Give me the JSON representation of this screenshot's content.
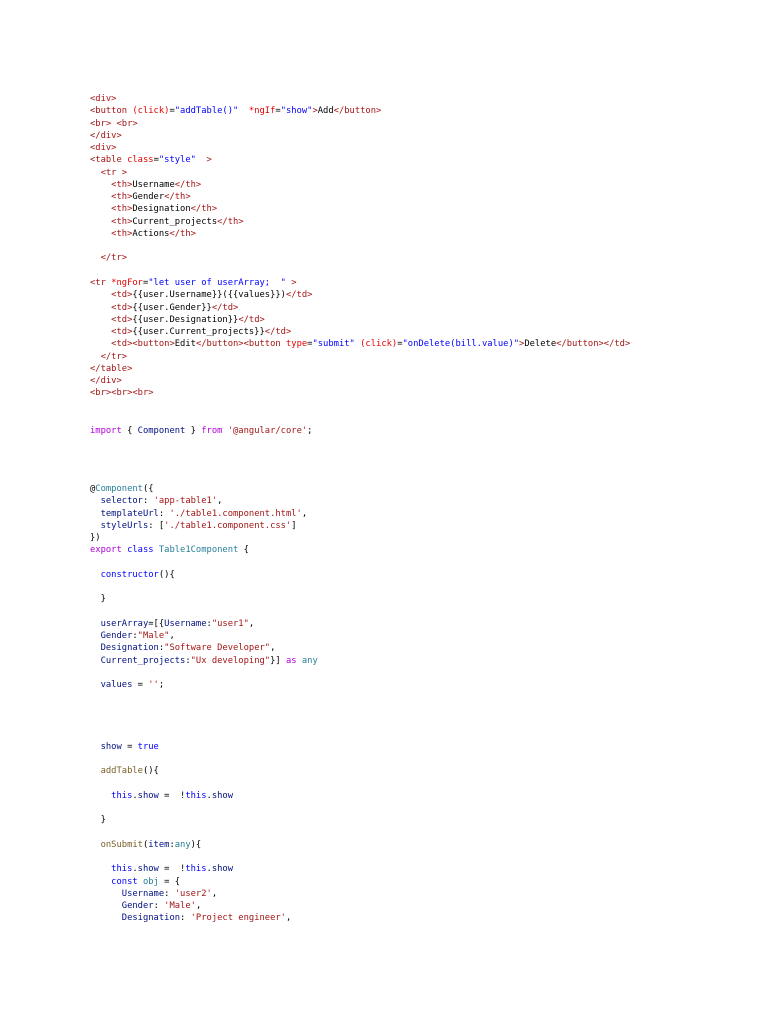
{
  "blocks": [
    {
      "name": "html-template-code",
      "lines": [
        [
          [
            "t",
            "<div>"
          ]
        ],
        [
          [
            "t",
            "<button "
          ],
          [
            "a",
            "(click)"
          ],
          [
            "x",
            "="
          ],
          [
            "v",
            "\"addTable()\""
          ],
          [
            "x",
            "  "
          ],
          [
            "a",
            "*ngIf"
          ],
          [
            "x",
            "="
          ],
          [
            "v",
            "\"show\""
          ],
          [
            "t",
            ">"
          ],
          [
            "x",
            "Add"
          ],
          [
            "t",
            "</button>"
          ]
        ],
        [
          [
            "t",
            "<br> <br>"
          ]
        ],
        [
          [
            "t",
            "</div>"
          ]
        ],
        [
          [
            "t",
            "<div>"
          ]
        ],
        [
          [
            "t",
            "<table "
          ],
          [
            "a",
            "class"
          ],
          [
            "x",
            "="
          ],
          [
            "v",
            "\"style\""
          ],
          [
            "t",
            "  >"
          ]
        ],
        [
          [
            "t",
            "  <tr >"
          ]
        ],
        [
          [
            "t",
            "    <th>"
          ],
          [
            "x",
            "Username"
          ],
          [
            "t",
            "</th>"
          ]
        ],
        [
          [
            "t",
            "    <th>"
          ],
          [
            "x",
            "Gender"
          ],
          [
            "t",
            "</th>"
          ]
        ],
        [
          [
            "t",
            "    <th>"
          ],
          [
            "x",
            "Designation"
          ],
          [
            "t",
            "</th>"
          ]
        ],
        [
          [
            "t",
            "    <th>"
          ],
          [
            "x",
            "Current_projects"
          ],
          [
            "t",
            "</th>"
          ]
        ],
        [
          [
            "t",
            "    <th>"
          ],
          [
            "x",
            "Actions"
          ],
          [
            "t",
            "</th>"
          ]
        ],
        [],
        [
          [
            "t",
            "  </tr>"
          ]
        ],
        [],
        [
          [
            "t",
            "<tr "
          ],
          [
            "a",
            "*ngFor"
          ],
          [
            "x",
            "="
          ],
          [
            "v",
            "\"let user of userArray;  \""
          ],
          [
            "t",
            " >"
          ]
        ],
        [
          [
            "t",
            "    <td>"
          ],
          [
            "x",
            "{{user.Username}}({{values}})"
          ],
          [
            "t",
            "</td>"
          ]
        ],
        [
          [
            "t",
            "    <td>"
          ],
          [
            "x",
            "{{user.Gender}}"
          ],
          [
            "t",
            "</td>"
          ]
        ],
        [
          [
            "t",
            "    <td>"
          ],
          [
            "x",
            "{{user.Designation}}"
          ],
          [
            "t",
            "</td>"
          ]
        ],
        [
          [
            "t",
            "    <td>"
          ],
          [
            "x",
            "{{user.Current_projects}}"
          ],
          [
            "t",
            "</td>"
          ]
        ],
        [
          [
            "t",
            "    <td><button>"
          ],
          [
            "x",
            "Edit"
          ],
          [
            "t",
            "</button><button "
          ],
          [
            "a",
            "type"
          ],
          [
            "x",
            "="
          ],
          [
            "v",
            "\"submit\""
          ],
          [
            "x",
            " "
          ],
          [
            "a",
            "(click)"
          ],
          [
            "x",
            "="
          ],
          [
            "v",
            "\"onDelete(bill.value)\""
          ],
          [
            "t",
            ">"
          ],
          [
            "x",
            "Delete"
          ],
          [
            "t",
            "</button></td>"
          ]
        ],
        [
          [
            "t",
            "  </tr>"
          ]
        ],
        [
          [
            "t",
            "</table>"
          ]
        ],
        [
          [
            "t",
            "</div>"
          ]
        ],
        [
          [
            "t",
            "<br><br><br>"
          ]
        ]
      ]
    },
    {
      "name": "import-code",
      "lines": [
        [
          [
            "k",
            "import"
          ],
          [
            "p",
            " { "
          ],
          [
            "i",
            "Component"
          ],
          [
            "p",
            " } "
          ],
          [
            "k",
            "from"
          ],
          [
            "p",
            " "
          ],
          [
            "s",
            "'@angular/core'"
          ],
          [
            "p",
            ";"
          ]
        ]
      ]
    },
    {
      "name": "component-code",
      "lines": [
        [
          [
            "p",
            "@"
          ],
          [
            "c",
            "Component"
          ],
          [
            "p",
            "({"
          ]
        ],
        [
          [
            "i",
            "  selector"
          ],
          [
            "p",
            ": "
          ],
          [
            "s",
            "'app-table1'"
          ],
          [
            "p",
            ","
          ]
        ],
        [
          [
            "i",
            "  templateUrl"
          ],
          [
            "p",
            ": "
          ],
          [
            "s",
            "'./table1.component.html'"
          ],
          [
            "p",
            ","
          ]
        ],
        [
          [
            "i",
            "  styleUrls"
          ],
          [
            "p",
            ": ["
          ],
          [
            "s",
            "'./table1.component.css'"
          ],
          [
            "p",
            "]"
          ]
        ],
        [
          [
            "p",
            "})"
          ]
        ],
        [
          [
            "k",
            "export"
          ],
          [
            "p",
            " "
          ],
          [
            "b",
            "class"
          ],
          [
            "p",
            " "
          ],
          [
            "c",
            "Table1Component"
          ],
          [
            "p",
            " {"
          ]
        ],
        [],
        [
          [
            "b",
            "  constructor"
          ],
          [
            "p",
            "(){"
          ]
        ],
        [],
        [
          [
            "p",
            "  }"
          ]
        ],
        [],
        [
          [
            "i",
            "  userArray"
          ],
          [
            "p",
            "=[{"
          ],
          [
            "i",
            "Username"
          ],
          [
            "p",
            ":"
          ],
          [
            "s",
            "\"user1\""
          ],
          [
            "p",
            ","
          ]
        ],
        [
          [
            "i",
            "  Gender"
          ],
          [
            "p",
            ":"
          ],
          [
            "s",
            "\"Male\""
          ],
          [
            "p",
            ","
          ]
        ],
        [
          [
            "i",
            "  Designation"
          ],
          [
            "p",
            ":"
          ],
          [
            "s",
            "\"Software Developer\""
          ],
          [
            "p",
            ","
          ]
        ],
        [
          [
            "i",
            "  Current_projects"
          ],
          [
            "p",
            ":"
          ],
          [
            "s",
            "\"Ux developing\""
          ],
          [
            "p",
            "}] "
          ],
          [
            "k",
            "as"
          ],
          [
            "p",
            " "
          ],
          [
            "c",
            "any"
          ]
        ],
        [],
        [
          [
            "i",
            "  values"
          ],
          [
            "p",
            " = "
          ],
          [
            "s",
            "''"
          ],
          [
            "p",
            ";"
          ]
        ],
        [],
        [],
        [],
        [],
        [
          [
            "i",
            "  show"
          ],
          [
            "p",
            " = "
          ],
          [
            "b",
            "true"
          ]
        ],
        [],
        [
          [
            "f",
            "  addTable"
          ],
          [
            "p",
            "(){"
          ]
        ],
        [],
        [
          [
            "b",
            "    this"
          ],
          [
            "p",
            "."
          ],
          [
            "i",
            "show"
          ],
          [
            "p",
            " =  !"
          ],
          [
            "b",
            "this"
          ],
          [
            "p",
            "."
          ],
          [
            "i",
            "show"
          ]
        ],
        [],
        [
          [
            "p",
            "  }"
          ]
        ],
        [],
        [
          [
            "f",
            "  onSubmit"
          ],
          [
            "p",
            "("
          ],
          [
            "i",
            "item"
          ],
          [
            "p",
            ":"
          ],
          [
            "c",
            "any"
          ],
          [
            "p",
            "){"
          ]
        ],
        [],
        [
          [
            "b",
            "    this"
          ],
          [
            "p",
            "."
          ],
          [
            "i",
            "show"
          ],
          [
            "p",
            " =  !"
          ],
          [
            "b",
            "this"
          ],
          [
            "p",
            "."
          ],
          [
            "i",
            "show"
          ]
        ],
        [
          [
            "b",
            "    const"
          ],
          [
            "p",
            " "
          ],
          [
            "c",
            "obj"
          ],
          [
            "p",
            " = {"
          ]
        ],
        [
          [
            "i",
            "      Username"
          ],
          [
            "p",
            ": "
          ],
          [
            "s",
            "'user2'"
          ],
          [
            "p",
            ","
          ]
        ],
        [
          [
            "i",
            "      Gender"
          ],
          [
            "p",
            ": "
          ],
          [
            "s",
            "'Male'"
          ],
          [
            "p",
            ","
          ]
        ],
        [
          [
            "i",
            "      Designation"
          ],
          [
            "p",
            ": "
          ],
          [
            "s",
            "'Project engineer'"
          ],
          [
            "p",
            ","
          ]
        ]
      ]
    }
  ]
}
